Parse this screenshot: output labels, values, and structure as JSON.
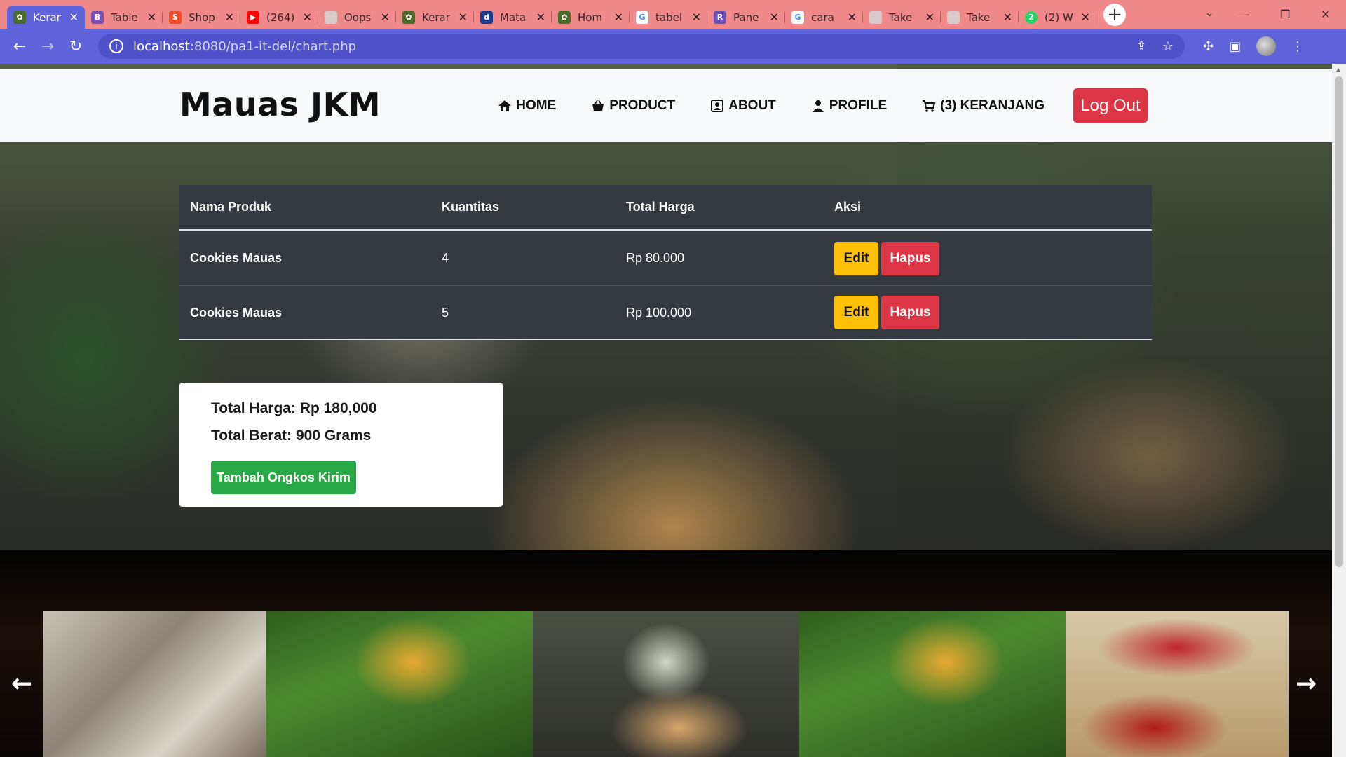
{
  "browser": {
    "tabs": [
      {
        "title": "Keran",
        "favicon": "leaf-icon",
        "color": "#4a6b2a",
        "active": true
      },
      {
        "title": "Table",
        "favicon": "bootstrap-icon",
        "color": "#7952b3"
      },
      {
        "title": "Shop",
        "favicon": "shopee-icon",
        "color": "#ee4d2d"
      },
      {
        "title": "(264)",
        "favicon": "youtube-icon",
        "color": "#ff0000"
      },
      {
        "title": "Oops",
        "favicon": "globe-icon",
        "color": "#cccccc"
      },
      {
        "title": "Keran",
        "favicon": "leaf-icon",
        "color": "#4a6b2a"
      },
      {
        "title": "Mata",
        "favicon": "del-icon",
        "color": "#1e3a8a"
      },
      {
        "title": "Hom",
        "favicon": "leaf-icon",
        "color": "#4a6b2a"
      },
      {
        "title": "tabel",
        "favicon": "google-icon",
        "color": "#ffffff"
      },
      {
        "title": "Pane",
        "favicon": "rc-icon",
        "color": "#6b4fbb"
      },
      {
        "title": "cara",
        "favicon": "google-icon",
        "color": "#ffffff"
      },
      {
        "title": "Take",
        "favicon": "globe-icon",
        "color": "#cccccc"
      },
      {
        "title": "Take",
        "favicon": "globe-icon",
        "color": "#cccccc"
      },
      {
        "title": "(2) W",
        "favicon": "whatsapp-icon",
        "color": "#25d366"
      }
    ],
    "url_host": "localhost",
    "url_path": ":8080/pa1-it-del/chart.php"
  },
  "navbar": {
    "brand": "Mauas JKM",
    "menu": [
      {
        "label": "HOME",
        "icon": "home-icon"
      },
      {
        "label": "PRODUCT",
        "icon": "basket-icon"
      },
      {
        "label": "ABOUT",
        "icon": "contact-card-icon"
      },
      {
        "label": "PROFILE",
        "icon": "person-icon"
      },
      {
        "label": "(3) KERANJANG",
        "icon": "cart-icon"
      }
    ],
    "logout_label": "Log Out"
  },
  "cart_table": {
    "headers": [
      "Nama Produk",
      "Kuantitas",
      "Total Harga",
      "Aksi"
    ],
    "rows": [
      {
        "product": "Cookies Mauas",
        "qty": "4",
        "total": "Rp 80.000",
        "edit": "Edit",
        "delete": "Hapus"
      },
      {
        "product": "Cookies Mauas",
        "qty": "5",
        "total": "Rp 100.000",
        "edit": "Edit",
        "delete": "Hapus"
      }
    ]
  },
  "summary": {
    "total_price": "Total Harga: Rp 180,000",
    "total_weight": "Total Berat: 900 Grams",
    "shipping_button": "Tambah Ongkos Kirim"
  },
  "gallery": {
    "prev": "←",
    "next": "→"
  },
  "colors": {
    "browser_accent": "#5f63d9",
    "tabbar": "#f08a8a",
    "logout": "#dc3545",
    "edit": "#ffc107",
    "hapus": "#dc3545",
    "ongkir": "#28a745",
    "table_bg": "#343a40"
  }
}
